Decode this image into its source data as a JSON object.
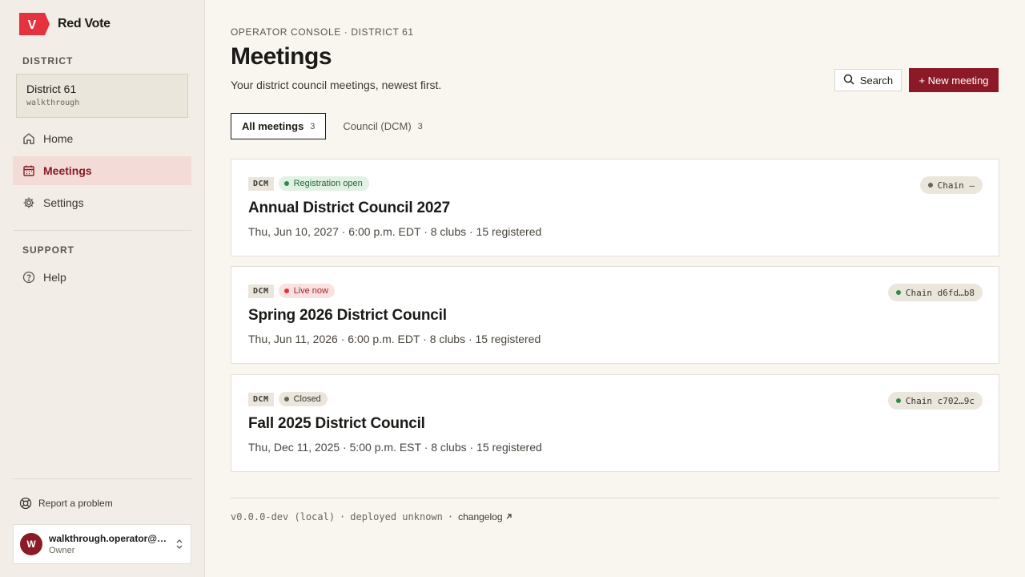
{
  "brand": {
    "name": "Red Vote",
    "logo_letter": "V",
    "accent": "#e5323f"
  },
  "sidebar": {
    "district_label": "DISTRICT",
    "district": {
      "name": "District 61",
      "sub": "walkthrough"
    },
    "items": [
      {
        "label": "Home",
        "icon": "home-icon",
        "active": false
      },
      {
        "label": "Meetings",
        "icon": "calendar-icon",
        "active": true
      },
      {
        "label": "Settings",
        "icon": "gear-icon",
        "active": false
      }
    ],
    "support_label": "SUPPORT",
    "support_items": [
      {
        "label": "Help",
        "icon": "help-circle-icon"
      }
    ],
    "report_label": "Report a problem",
    "user": {
      "initial": "W",
      "email": "walkthrough.operator@ta...",
      "role": "Owner"
    }
  },
  "header": {
    "eyebrow": "OPERATOR CONSOLE · DISTRICT 61",
    "title": "Meetings",
    "subtitle": "Your district council meetings, newest first.",
    "search_label": "Search",
    "new_label": "+ New meeting"
  },
  "tabs": [
    {
      "label": "All meetings",
      "count": "3",
      "active": true
    },
    {
      "label": "Council (DCM)",
      "count": "3",
      "active": false
    }
  ],
  "meetings": [
    {
      "type": "DCM",
      "status": "Registration open",
      "status_kind": "open",
      "title": "Annual District Council 2027",
      "meta": "Thu, Jun 10, 2027 · 6:00 p.m. EDT · 8 clubs · 15 registered",
      "chain": "Chain —",
      "chain_color": "#6a655c"
    },
    {
      "type": "DCM",
      "status": "Live now",
      "status_kind": "live",
      "title": "Spring 2026 District Council",
      "meta": "Thu, Jun 11, 2026 · 6:00 p.m. EDT · 8 clubs · 15 registered",
      "chain": "Chain d6fd…b8",
      "chain_color": "#2e8b4a"
    },
    {
      "type": "DCM",
      "status": "Closed",
      "status_kind": "closed",
      "title": "Fall 2025 District Council",
      "meta": "Thu, Dec 11, 2025 · 5:00 p.m. EST · 8 clubs · 15 registered",
      "chain": "Chain c702…9c",
      "chain_color": "#2e8b4a"
    }
  ],
  "footer": {
    "version": "v0.0.0-dev (local)",
    "sep": "·",
    "deployed": "deployed unknown",
    "changelog": "changelog"
  },
  "colors": {
    "primary": "#8b1a26",
    "open_bg": "#e2f1e4",
    "open_fg": "#1f6b35",
    "open_dot": "#2e8b4a",
    "live_bg": "#fbe1e0",
    "live_fg": "#a3202c",
    "live_dot": "#e5323f",
    "closed_bg": "#ebe6dc",
    "closed_fg": "#3b3731",
    "closed_dot": "#6a655c"
  }
}
